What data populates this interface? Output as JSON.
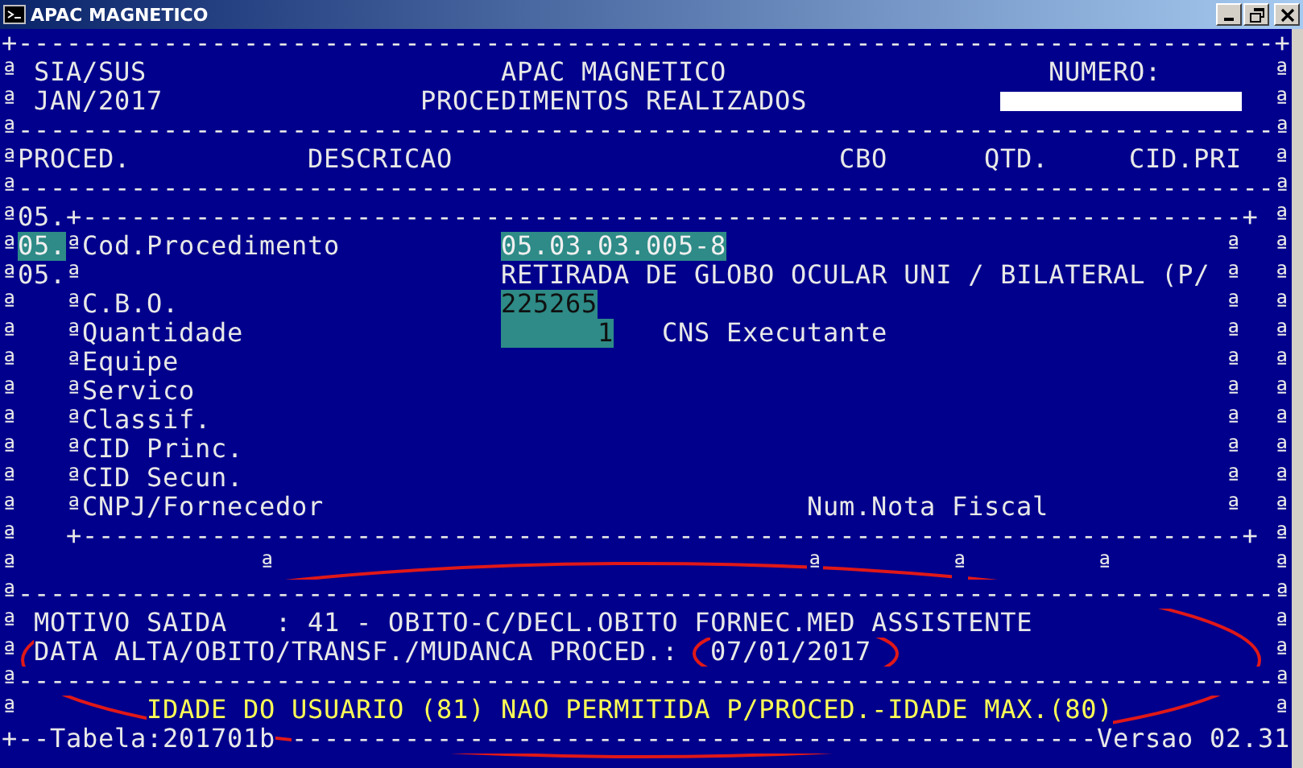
{
  "window": {
    "title": "APAC MAGNETICO"
  },
  "rows": [
    {
      "cells": [
        {
          "kind": "rule",
          "text": "+------------------------------------------------------------------------------+"
        }
      ]
    },
    {
      "cells": [
        {
          "kind": "mark",
          "text": "ª"
        },
        {
          "kind": "label",
          "text": "SIA/SUS"
        },
        {
          "kind": "title",
          "text": "APAC MAGNETICO"
        },
        {
          "kind": "label",
          "text": "NUMERO:"
        },
        {
          "kind": "mark",
          "text": "ª"
        }
      ]
    },
    {
      "cells": [
        {
          "kind": "mark",
          "text": "ª"
        },
        {
          "kind": "label",
          "text": "JAN/2017"
        },
        {
          "kind": "title",
          "text": "PROCEDIMENTOS REALIZADOS"
        },
        {
          "kind": "field"
        },
        {
          "kind": "mark",
          "text": "ª"
        }
      ]
    },
    {
      "cells": [
        {
          "kind": "rule",
          "text": "ª------------------------------------------------------------------------------ª"
        }
      ]
    },
    {
      "cells": [
        {
          "kind": "heading",
          "text": "ªPROCED."
        },
        {
          "kind": "heading",
          "text": "DESCRICAO"
        },
        {
          "kind": "heading",
          "text": "CBO"
        },
        {
          "kind": "heading",
          "text": "QTD."
        },
        {
          "kind": "heading",
          "text": "CID.PRI"
        },
        {
          "kind": "mark",
          "text": "ª"
        }
      ]
    },
    {
      "cells": [
        {
          "kind": "rule",
          "text": "ª------------------------------------------------------------------------------ª"
        }
      ]
    },
    {
      "cells": [
        {
          "kind": "label",
          "text": "ª05."
        },
        {
          "kind": "rule",
          "text": "+------------------------------------------------------------------------+"
        },
        {
          "kind": "mark",
          "text": "ª"
        }
      ]
    },
    {
      "cells": [
        {
          "kind": "mark",
          "text": "ª"
        },
        {
          "kind": "value_active",
          "text": "05."
        },
        {
          "kind": "label",
          "text": "ªCod.Procedimento"
        },
        {
          "kind": "value_active",
          "text": "05.03.03.005-8"
        },
        {
          "kind": "mark",
          "text": "ª"
        },
        {
          "kind": "mark",
          "text": "ª"
        }
      ]
    },
    {
      "cells": [
        {
          "kind": "label",
          "text": "ª05.ª"
        },
        {
          "kind": "label",
          "text": "RETIRADA DE GLOBO OCULAR UNI / BILATERAL (P/"
        },
        {
          "kind": "mark",
          "text": "ª"
        },
        {
          "kind": "mark",
          "text": "ª"
        }
      ]
    },
    {
      "cells": [
        {
          "kind": "mark",
          "text": "ª"
        },
        {
          "kind": "label",
          "text": "ªC.B.O."
        },
        {
          "kind": "value",
          "text": "225265"
        },
        {
          "kind": "mark",
          "text": "ª"
        },
        {
          "kind": "mark",
          "text": "ª"
        }
      ]
    },
    {
      "cells": [
        {
          "kind": "mark",
          "text": "ª"
        },
        {
          "kind": "label",
          "text": "ªQuantidade"
        },
        {
          "kind": "value",
          "text": "1"
        },
        {
          "kind": "label",
          "text": "CNS Executante"
        },
        {
          "kind": "mark",
          "text": "ª"
        },
        {
          "kind": "mark",
          "text": "ª"
        }
      ]
    },
    {
      "cells": [
        {
          "kind": "mark",
          "text": "ª"
        },
        {
          "kind": "label",
          "text": "ªEquipe"
        },
        {
          "kind": "mark",
          "text": "ª"
        },
        {
          "kind": "mark",
          "text": "ª"
        }
      ]
    },
    {
      "cells": [
        {
          "kind": "mark",
          "text": "ª"
        },
        {
          "kind": "label",
          "text": "ªServico"
        },
        {
          "kind": "mark",
          "text": "ª"
        },
        {
          "kind": "mark",
          "text": "ª"
        }
      ]
    },
    {
      "cells": [
        {
          "kind": "mark",
          "text": "ª"
        },
        {
          "kind": "label",
          "text": "ªClassif."
        },
        {
          "kind": "mark",
          "text": "ª"
        },
        {
          "kind": "mark",
          "text": "ª"
        }
      ]
    },
    {
      "cells": [
        {
          "kind": "mark",
          "text": "ª"
        },
        {
          "kind": "label",
          "text": "ªCID Princ."
        },
        {
          "kind": "mark",
          "text": "ª"
        },
        {
          "kind": "mark",
          "text": "ª"
        }
      ]
    },
    {
      "cells": [
        {
          "kind": "mark",
          "text": "ª"
        },
        {
          "kind": "label",
          "text": "ªCID Secun."
        },
        {
          "kind": "mark",
          "text": "ª"
        },
        {
          "kind": "mark",
          "text": "ª"
        }
      ]
    },
    {
      "cells": [
        {
          "kind": "mark",
          "text": "ª"
        },
        {
          "kind": "label",
          "text": "ªCNPJ/Fornecedor"
        },
        {
          "kind": "label",
          "text": "Num.Nota Fiscal"
        },
        {
          "kind": "mark",
          "text": "ª"
        },
        {
          "kind": "mark",
          "text": "ª"
        }
      ]
    },
    {
      "cells": [
        {
          "kind": "mark",
          "text": "ª"
        },
        {
          "kind": "rule",
          "text": "+------------------------------------------------------------------------+"
        },
        {
          "kind": "mark",
          "text": "ª"
        }
      ]
    },
    {
      "cells": [
        {
          "kind": "mark",
          "text": "ª"
        },
        {
          "kind": "mark",
          "text": "ª"
        },
        {
          "kind": "mark",
          "text": "ª"
        },
        {
          "kind": "mark",
          "text": "ª"
        },
        {
          "kind": "mark",
          "text": "ª"
        },
        {
          "kind": "mark",
          "text": "ª"
        }
      ]
    },
    {
      "cells": [
        {
          "kind": "rule",
          "text": "ª------------------------------------------------------------------------------ª"
        }
      ]
    },
    {
      "cells": [
        {
          "kind": "mark",
          "text": "ª"
        },
        {
          "kind": "label",
          "text": "MOTIVO SAIDA   : 41 - OBITO-C/DECL.OBITO FORNEC.MED ASSISTENTE"
        },
        {
          "kind": "mark",
          "text": "ª"
        }
      ]
    },
    {
      "cells": [
        {
          "kind": "mark",
          "text": "ª"
        },
        {
          "kind": "label",
          "text": "DATA ALTA/OBITO/TRANSF./MUDANCA PROCED.:"
        },
        {
          "kind": "label",
          "text": "07/01/2017"
        },
        {
          "kind": "mark",
          "text": "ª"
        }
      ]
    },
    {
      "cells": [
        {
          "kind": "rule",
          "text": "ª------------------------------------------------------------------------------ª"
        }
      ]
    },
    {
      "cells": [
        {
          "kind": "mark",
          "text": "ª"
        },
        {
          "kind": "warning",
          "text": "IDADE DO USUARIO (81) NAO PERMITIDA P/PROCED.-IDADE MAX.(80)"
        },
        {
          "kind": "mark",
          "text": "ª"
        }
      ]
    },
    {
      "cells": [
        {
          "kind": "label",
          "text": "+--Tabela:201701b"
        },
        {
          "kind": "rule",
          "text": "--------------------------------------------------"
        },
        {
          "kind": "label",
          "text": "Versao 02.31"
        }
      ]
    }
  ],
  "annotations": [
    {
      "kind": "ellipse"
    },
    {
      "kind": "ellipse"
    }
  ]
}
